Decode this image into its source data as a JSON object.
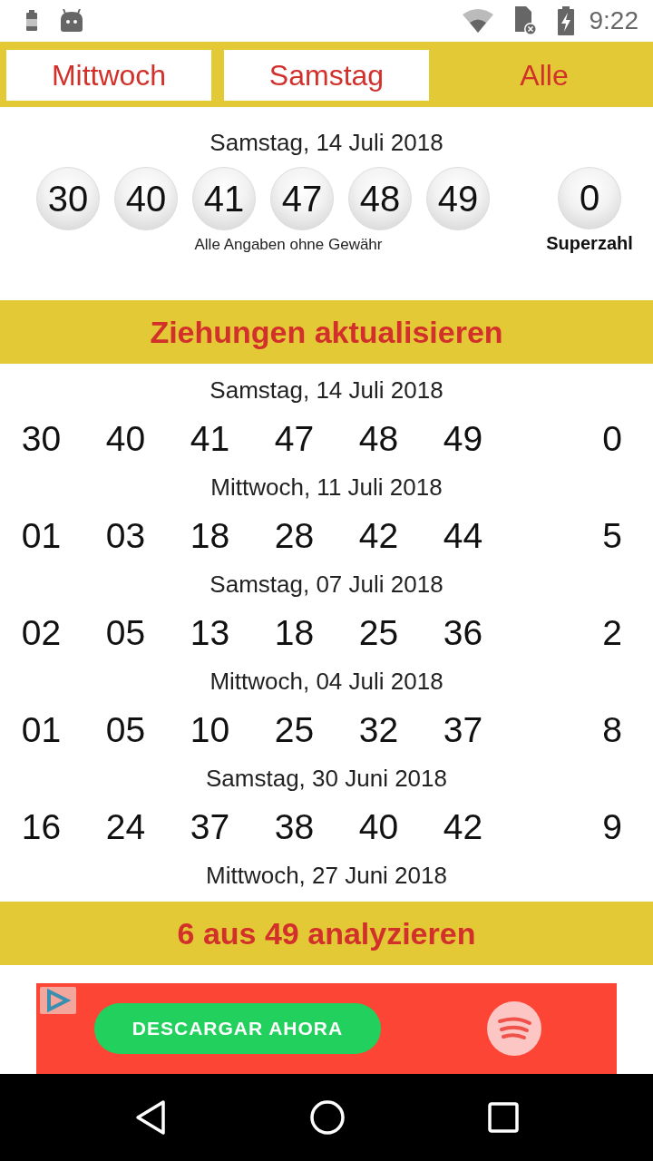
{
  "status_bar": {
    "time": "9:22"
  },
  "tabs": [
    {
      "label": "Mittwoch",
      "selected": false
    },
    {
      "label": "Samstag",
      "selected": false
    },
    {
      "label": "Alle",
      "selected": true
    }
  ],
  "latest": {
    "date": "Samstag, 14 Juli 2018",
    "numbers": [
      "30",
      "40",
      "41",
      "47",
      "48",
      "49"
    ],
    "superzahl": "0",
    "superzahl_label": "Superzahl",
    "disclaimer": "Alle Angaben ohne Gewähr"
  },
  "refresh_button": "Ziehungen aktualisieren",
  "draws": [
    {
      "date": "Samstag, 14 Juli 2018",
      "numbers": [
        "30",
        "40",
        "41",
        "47",
        "48",
        "49"
      ],
      "superzahl": "0"
    },
    {
      "date": "Mittwoch, 11 Juli 2018",
      "numbers": [
        "01",
        "03",
        "18",
        "28",
        "42",
        "44"
      ],
      "superzahl": "5"
    },
    {
      "date": "Samstag, 07 Juli 2018",
      "numbers": [
        "02",
        "05",
        "13",
        "18",
        "25",
        "36"
      ],
      "superzahl": "2"
    },
    {
      "date": "Mittwoch, 04 Juli 2018",
      "numbers": [
        "01",
        "05",
        "10",
        "25",
        "32",
        "37"
      ],
      "superzahl": "8"
    },
    {
      "date": "Samstag, 30 Juni 2018",
      "numbers": [
        "16",
        "24",
        "37",
        "38",
        "40",
        "42"
      ],
      "superzahl": "9"
    },
    {
      "date": "Mittwoch, 27 Juni 2018"
    }
  ],
  "analyze_button": "6 aus 49 analyzieren",
  "ad": {
    "button": "DESCARGAR AHORA"
  }
}
